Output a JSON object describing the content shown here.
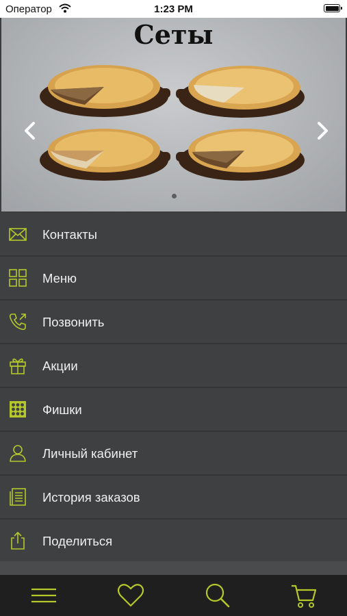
{
  "status_bar": {
    "carrier": "Оператор",
    "time": "1:23 PM"
  },
  "banner": {
    "title": "Сеты",
    "page_count": 1,
    "current_page": 1
  },
  "menu": {
    "items": [
      {
        "label": "Контакты",
        "icon": "envelope-icon"
      },
      {
        "label": "Меню",
        "icon": "grid-icon"
      },
      {
        "label": "Позвонить",
        "icon": "phone-icon"
      },
      {
        "label": "Акции",
        "icon": "gift-icon"
      },
      {
        "label": "Фишки",
        "icon": "chip-icon"
      },
      {
        "label": "Личный кабинет",
        "icon": "user-icon"
      },
      {
        "label": "История заказов",
        "icon": "history-icon"
      },
      {
        "label": "Поделиться",
        "icon": "share-icon"
      }
    ]
  },
  "tab_bar": {
    "items": [
      {
        "icon": "hamburger-menu-icon"
      },
      {
        "icon": "heart-icon"
      },
      {
        "icon": "search-icon"
      },
      {
        "icon": "cart-icon"
      }
    ]
  },
  "colors": {
    "accent": "#b5c92a",
    "menu_bg": "#3f4042",
    "tab_bar_bg": "#1f1f1f",
    "text": "#f0f0f0"
  }
}
